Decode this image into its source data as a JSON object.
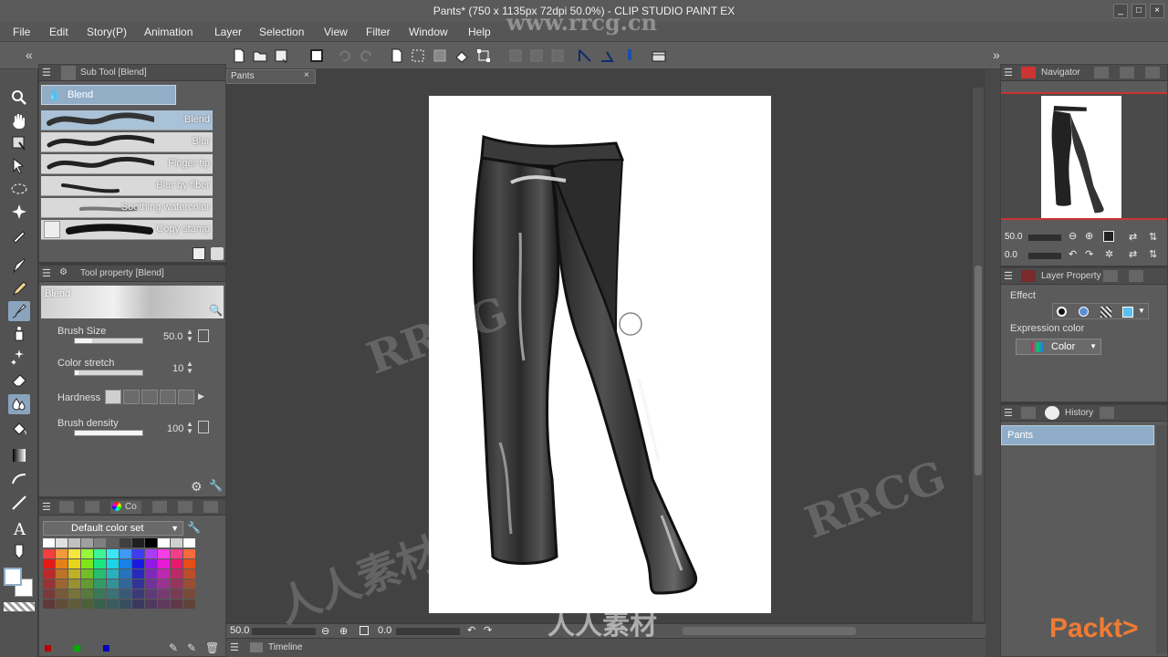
{
  "window": {
    "title": "Pants* (750 x 1135px 72dpi 50.0%) - CLIP STUDIO PAINT EX",
    "watermark_site": "www.rrcg.cn",
    "watermarks": [
      "RRCG",
      "人人素材"
    ],
    "logo": "Packt>"
  },
  "menu": [
    "File",
    "Edit",
    "Story(P)",
    "Animation",
    "Layer",
    "Selection",
    "View",
    "Filter",
    "Window",
    "Help"
  ],
  "canvas_tab": "Pants",
  "subtool": {
    "header": "Sub Tool [Blend]",
    "group": "Blend",
    "brushes": [
      "Blend",
      "Blur",
      "Finger tip",
      "Blur by fiber",
      "Soothing watercolor",
      "Copy stamp"
    ]
  },
  "toolprop": {
    "header": "Tool property [Blend]",
    "preview_label": "Blend",
    "brush_size_label": "Brush Size",
    "brush_size": "50.0",
    "brush_size_fraction": 0.25,
    "color_stretch_label": "Color stretch",
    "color_stretch": "10",
    "color_stretch_fraction": 0.05,
    "hardness_label": "Hardness",
    "brush_density_label": "Brush density",
    "brush_density": "100",
    "brush_density_fraction": 1.0
  },
  "color": {
    "tab": "Co",
    "set_name": "Default color set"
  },
  "status": {
    "zoom": "50.0",
    "rotation": "0.0"
  },
  "timeline_label": "Timeline",
  "navigator": {
    "header": "Navigator",
    "zoom": "50.0",
    "rotation": "0.0"
  },
  "layerprop": {
    "header": "Layer Property",
    "effect_label": "Effect",
    "expression_label": "Expression color",
    "expression_value": "Color"
  },
  "history": {
    "header": "History",
    "entries": [
      "Pants"
    ]
  },
  "colors": {
    "accent": "#8fadc8",
    "panel": "#5b5b5b",
    "canvas_bg": "#424242"
  }
}
